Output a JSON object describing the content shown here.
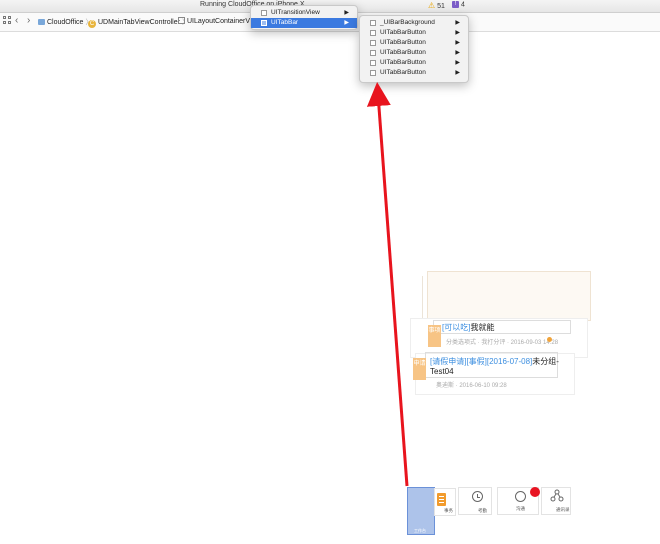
{
  "status": {
    "running_text": "Running CloudOffice on iPhone X",
    "warnings": "51",
    "issues": "4"
  },
  "breadcrumb": [
    {
      "label": "CloudOffice",
      "icon": "folder-icon"
    },
    {
      "label": "UDMainTabViewController",
      "icon": "class-icon"
    },
    {
      "label": "UILayoutContainerView",
      "icon": "view-icon"
    }
  ],
  "menu_level1": [
    {
      "label": "UITransitionView",
      "selected": false
    },
    {
      "label": "UITabBar",
      "selected": true
    }
  ],
  "menu_level2": [
    {
      "label": "_UIBarBackground"
    },
    {
      "label": "UITabBarButton"
    },
    {
      "label": "UITabBarButton"
    },
    {
      "label": "UITabBarButton"
    },
    {
      "label": "UITabBarButton"
    },
    {
      "label": "UITabBarButton"
    }
  ],
  "submenu_arrow": "▶",
  "cards": {
    "card1": {
      "tag": "事项",
      "title_link": "[可以吃]",
      "title_rest": "我就能",
      "sub": "分类选项式 · 我打分评 · 2016-09-03 14:28"
    },
    "card2": {
      "tag": "申请",
      "title_link": "[请假申请][事假][2016-07-08]",
      "title_rest": "未分组-",
      "title_line2": "Test04",
      "sub": "奥迪斯 · 2016-06-10 09:28"
    }
  },
  "tabbar": {
    "tab1_label": "工作台",
    "tab2_label": "事务",
    "tab3_label": "考勤",
    "tab4_label": "沟通",
    "tab5_label": "通讯录"
  },
  "colors": {
    "menu_selected": "#3b7ae0",
    "arrow": "#e8141e",
    "tab_highlight": "#a5bde8",
    "link_blue": "#3d8fe0",
    "tag_orange": "#f7c485",
    "badge_red": "#e81422"
  }
}
